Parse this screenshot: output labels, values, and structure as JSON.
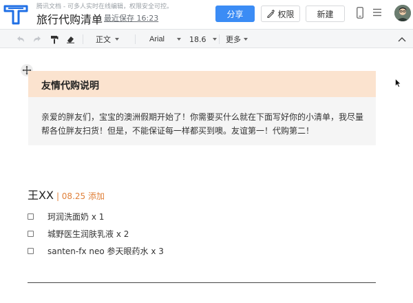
{
  "header": {
    "app_name": "腾讯文档 - 可多人实时在线编辑，权限安全可控。",
    "doc_title": "旅行代购清单",
    "last_saved": "最近保存 16:23",
    "share_label": "分享",
    "permission_label": "权限",
    "new_label": "新建"
  },
  "toolbar": {
    "paragraph_style": "正文",
    "font_name": "Arial",
    "font_size": "18.6",
    "more_label": "更多"
  },
  "notice": {
    "title": "友情代购说明",
    "body": "亲爱的胖友们，宝宝的澳洲假期开始了！你需要买什么就在下面写好你的小清单，我尽量帮各位胖友扫货！但是，不能保证每一样都买到噢。友谊第一！代购第二！"
  },
  "list": {
    "owner_name": "王XX",
    "owner_note": "| 08.25 添加",
    "items": [
      {
        "text": "珂润洗面奶 x 1",
        "checked": false
      },
      {
        "text": "城野医生润肤乳液 x 2",
        "checked": false
      },
      {
        "text": "santen-fx neo 参天眼药水 x 3",
        "checked": false
      }
    ]
  },
  "colors": {
    "accent": "#3b8cf5",
    "notice_header": "#fbe3cf",
    "notice_body": "#f5f5f5",
    "note_orange": "#e0803a"
  },
  "icons": [
    "logo-icon",
    "shield-icon",
    "phone-icon",
    "menu-icon",
    "undo-icon",
    "redo-icon",
    "format-painter-icon",
    "eraser-icon",
    "move-icon",
    "collapse-icon"
  ]
}
